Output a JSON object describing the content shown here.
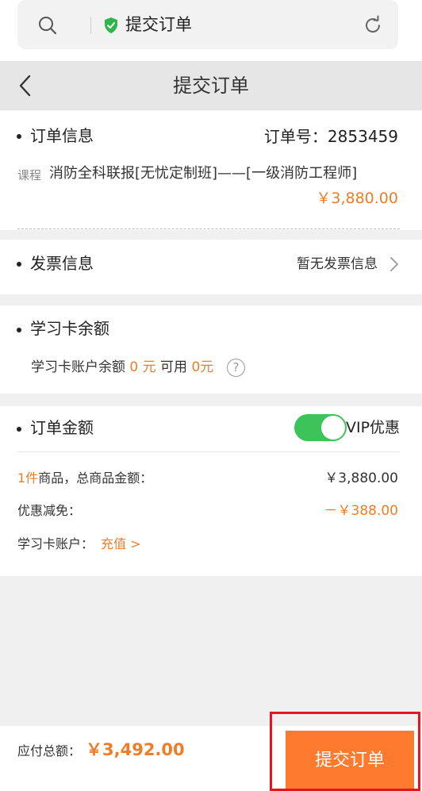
{
  "browser": {
    "address_title": "提交订单"
  },
  "nav": {
    "title": "提交订单"
  },
  "order": {
    "section_title": "订单信息",
    "order_no_label": "订单号：",
    "order_no": "2853459",
    "course_tag": "课程",
    "course_name": "消防全科联报[无忧定制班]——[一级消防工程师]",
    "course_price": "￥3,880.00"
  },
  "invoice": {
    "section_title": "发票信息",
    "value": "暂无发票信息"
  },
  "study_card": {
    "section_title": "学习卡余额",
    "balance_label": "学习卡账户余额",
    "balance_value": "0 元",
    "available_label": "可用",
    "available_value": "0元",
    "help_glyph": "?"
  },
  "amount": {
    "section_title": "订单金额",
    "vip_toggle_on": true,
    "vip_label": "VIP优惠",
    "items_count": "1件",
    "items_label": "商品，总商品金额：",
    "items_total": "￥3,880.00",
    "discount_label": "优惠减免：",
    "discount_value": "－￥388.00",
    "card_account_label": "学习卡账户：",
    "recharge_link": "充值 >"
  },
  "footer": {
    "total_label": "应付总额：",
    "total_value": "￥3,492.00",
    "submit_label": "提交订单"
  },
  "colors": {
    "accent": "#f07c28",
    "button": "#fd7a2e",
    "toggle_on": "#3cc45a",
    "highlight": "#e8141b"
  }
}
